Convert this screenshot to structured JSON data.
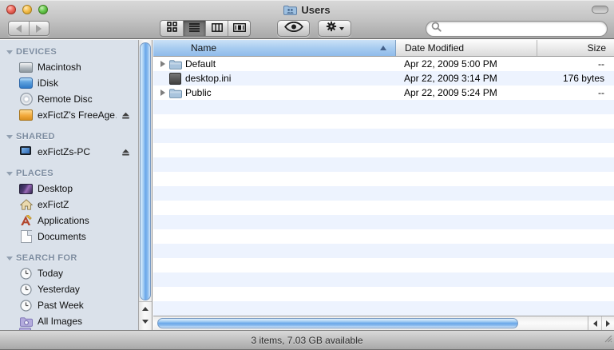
{
  "window": {
    "title": "Users",
    "title_icon": "users-folder-icon",
    "controls": {
      "close": "close",
      "minimize": "minimize",
      "zoom": "zoom"
    }
  },
  "toolbar": {
    "back_icon": "back-arrow-icon",
    "forward_icon": "forward-arrow-icon",
    "view_modes": [
      {
        "id": "icon-view",
        "icon": "icon-view-icon",
        "selected": false
      },
      {
        "id": "list-view",
        "icon": "list-view-icon",
        "selected": true
      },
      {
        "id": "column-view",
        "icon": "column-view-icon",
        "selected": false
      },
      {
        "id": "coverflow-view",
        "icon": "coverflow-view-icon",
        "selected": false
      }
    ],
    "quicklook_icon": "eye-icon",
    "action_icon": "gear-icon",
    "search": {
      "value": "",
      "icon": "magnifier-icon"
    }
  },
  "sidebar": {
    "sections": [
      {
        "label": "DEVICES",
        "items": [
          {
            "label": "Macintosh",
            "icon": "internal-drive-icon",
            "ejectable": false
          },
          {
            "label": "iDisk",
            "icon": "idisk-icon",
            "ejectable": false
          },
          {
            "label": "Remote Disc",
            "icon": "disc-icon",
            "ejectable": false
          },
          {
            "label": "exFictZ's FreeAge…",
            "icon": "external-drive-icon",
            "ejectable": true
          }
        ]
      },
      {
        "label": "SHARED",
        "items": [
          {
            "label": "exFictZs-PC",
            "icon": "computer-icon",
            "ejectable": true
          }
        ]
      },
      {
        "label": "PLACES",
        "items": [
          {
            "label": "Desktop",
            "icon": "desktop-icon",
            "ejectable": false
          },
          {
            "label": "exFictZ",
            "icon": "home-icon",
            "ejectable": false
          },
          {
            "label": "Applications",
            "icon": "applications-icon",
            "ejectable": false
          },
          {
            "label": "Documents",
            "icon": "document-icon",
            "ejectable": false
          }
        ]
      },
      {
        "label": "SEARCH FOR",
        "items": [
          {
            "label": "Today",
            "icon": "clock-icon",
            "ejectable": false
          },
          {
            "label": "Yesterday",
            "icon": "clock-icon",
            "ejectable": false
          },
          {
            "label": "Past Week",
            "icon": "clock-icon",
            "ejectable": false
          },
          {
            "label": "All Images",
            "icon": "smart-folder-icon",
            "ejectable": false
          }
        ]
      }
    ]
  },
  "list": {
    "columns": [
      {
        "label": "Name",
        "sort": "asc"
      },
      {
        "label": "Date Modified",
        "sort": null
      },
      {
        "label": "Size",
        "sort": null
      }
    ],
    "rows": [
      {
        "name": "Default",
        "type": "folder",
        "expandable": true,
        "date_modified": "Apr 22, 2009 5:00 PM",
        "size": "--"
      },
      {
        "name": "desktop.ini",
        "type": "file",
        "expandable": false,
        "date_modified": "Apr 22, 2009 3:14 PM",
        "size": "176 bytes"
      },
      {
        "name": "Public",
        "type": "folder",
        "expandable": true,
        "date_modified": "Apr 22, 2009 5:24 PM",
        "size": "--"
      }
    ]
  },
  "status_bar": {
    "text": "3 items, 7.03 GB available"
  },
  "colors": {
    "header_selected": "#8fbbea",
    "row_stripe": "#edf3fe",
    "sidebar_bg": "#dae1ea",
    "scrollbar_blue": "#6aa7e9",
    "traffic_red": "#ee6a5e",
    "traffic_yellow": "#f5bf4f",
    "traffic_green": "#67c94f"
  }
}
